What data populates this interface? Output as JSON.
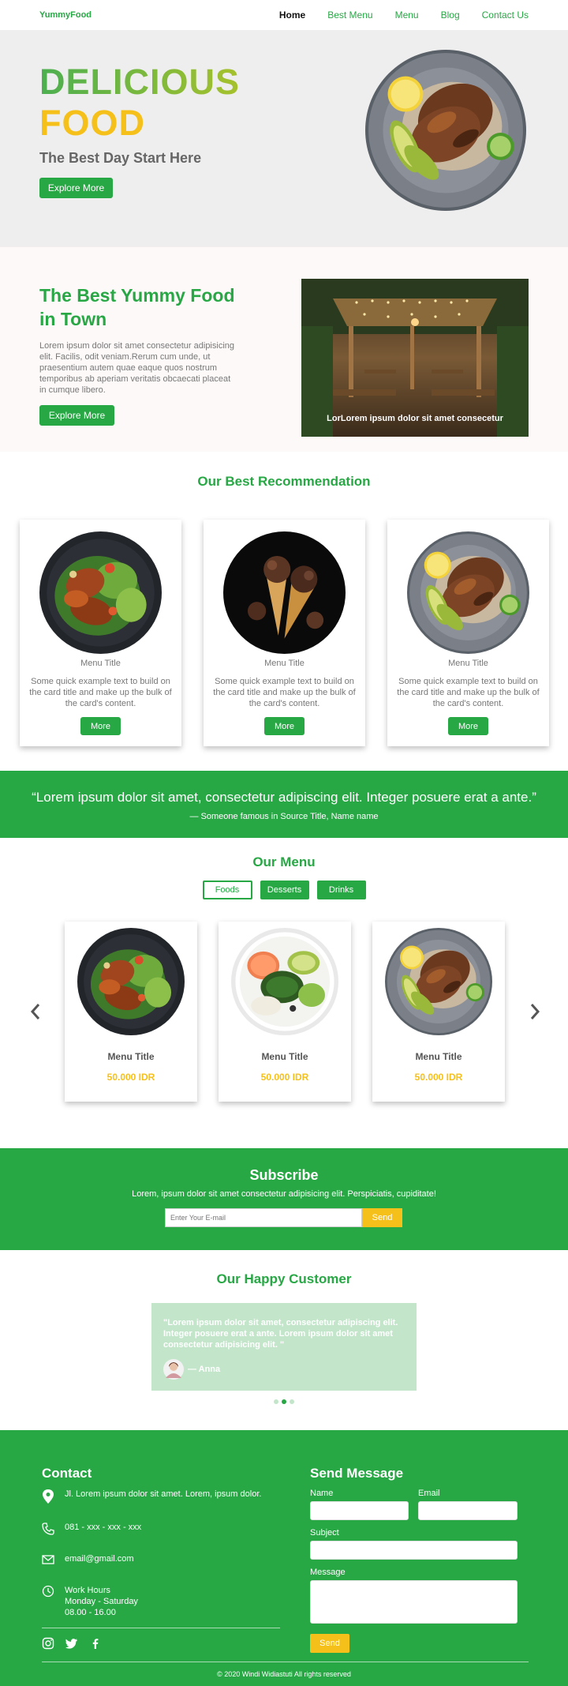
{
  "nav": {
    "brand": "YummyFood",
    "links": [
      "Home",
      "Best Menu",
      "Menu",
      "Blog",
      "Contact Us"
    ]
  },
  "hero": {
    "title_line1": "DELICIOUS",
    "title_line2": "FOOD",
    "subtitle": "The Best Day Start Here",
    "button": "Explore More"
  },
  "about": {
    "title": "The Best Yummy Food in Town",
    "text": "Lorem ipsum dolor sit amet consectetur adipisicing elit. Facilis, odit veniam.Rerum cum unde, ut praesentium autem quae eaque quos nostrum temporibus ab aperiam veritatis obcaecati placeat in cumque libero.",
    "button": "Explore More",
    "image_caption": "LorLorem ipsum dolor sit amet consecetur"
  },
  "recommendation": {
    "title": "Our Best Recommendation",
    "cards": [
      {
        "title": "Menu Title",
        "text": "Some quick example text to build on the card title and make up the bulk of the card's content.",
        "button": "More"
      },
      {
        "title": "Menu Title",
        "text": "Some quick example text to build on the card title and make up the bulk of the card's content.",
        "button": "More"
      },
      {
        "title": "Menu Title",
        "text": "Some quick example text to build on the card title and make up the bulk of the card's content.",
        "button": "More"
      }
    ]
  },
  "quote": {
    "text": "“Lorem ipsum dolor sit amet, consectetur adipiscing elit. Integer posuere erat a ante.”",
    "source": "— Someone famous in Source Title, Name name"
  },
  "menu": {
    "title": "Our Menu",
    "tabs": [
      "Foods",
      "Desserts",
      "Drinks"
    ],
    "items": [
      {
        "title": "Menu Title",
        "price": "50.000 IDR"
      },
      {
        "title": "Menu Title",
        "price": "50.000 IDR"
      },
      {
        "title": "Menu Title",
        "price": "50.000 IDR"
      }
    ]
  },
  "subscribe": {
    "title": "Subscribe",
    "text": "Lorem, ipsum dolor sit amet consectetur adipisicing elit. Perspiciatis, cupiditate!",
    "placeholder": "Enter Your E-mail",
    "button": "Send"
  },
  "customers": {
    "title": "Our Happy Customer",
    "quote": "\"Lorem ipsum dolor sit amet, consectetur adipiscing elit. Integer posuere erat a ante. Lorem ipsum dolor sit amet consectetur adipisicing elit. \"",
    "author": "— Anna"
  },
  "footer": {
    "contact_title": "Contact",
    "address": "Jl. Lorem ipsum dolor sit amet. Lorem, ipsum dolor.",
    "phone": "081 - xxx - xxx - xxx",
    "email": "email@gmail.com",
    "hours_label": "Work Hours",
    "hours_days": "Monday - Saturday",
    "hours_time": "08.00 - 16.00",
    "message_title": "Send Message",
    "name_label": "Name",
    "email_label": "Email",
    "subject_label": "Subject",
    "message_label": "Message",
    "send_button": "Send",
    "copyright": "© 2020 Windi Widiastuti All rights reserved"
  },
  "colors": {
    "green": "#28a745",
    "yellow": "#f6c01b",
    "light_green": "#c3e6cb",
    "hero_bg": "#eeeeee"
  }
}
